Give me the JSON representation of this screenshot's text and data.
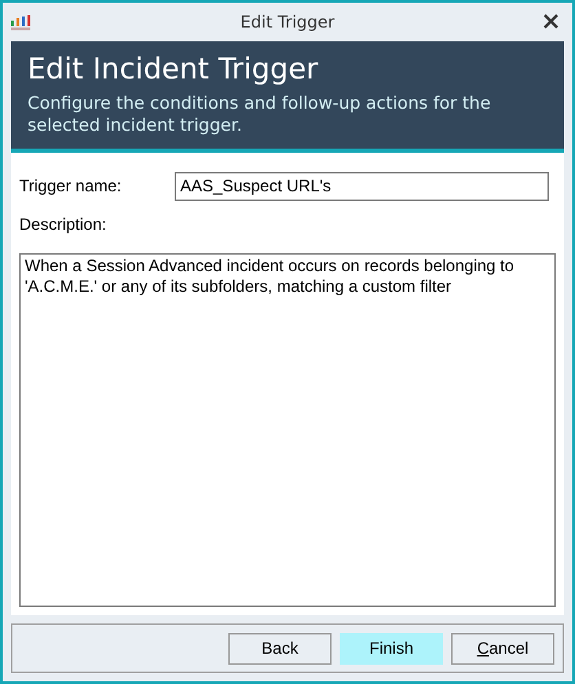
{
  "window": {
    "title": "Edit Trigger"
  },
  "header": {
    "title": "Edit Incident Trigger",
    "subtitle": "Configure the conditions and follow-up actions for the selected incident trigger."
  },
  "form": {
    "name_label": "Trigger name:",
    "name_value": "AAS_Suspect URL's",
    "description_label": "Description:",
    "description_value": "When a Session Advanced incident occurs on records belonging to 'A.C.M.E.' or any of its subfolders, matching a custom filter"
  },
  "buttons": [
    {
      "label": "Back",
      "highlighted": false,
      "mnemonic": false
    },
    {
      "label": "Finish",
      "highlighted": true,
      "mnemonic": false
    },
    {
      "label": "Cancel",
      "highlighted": false,
      "mnemonic": true
    }
  ]
}
